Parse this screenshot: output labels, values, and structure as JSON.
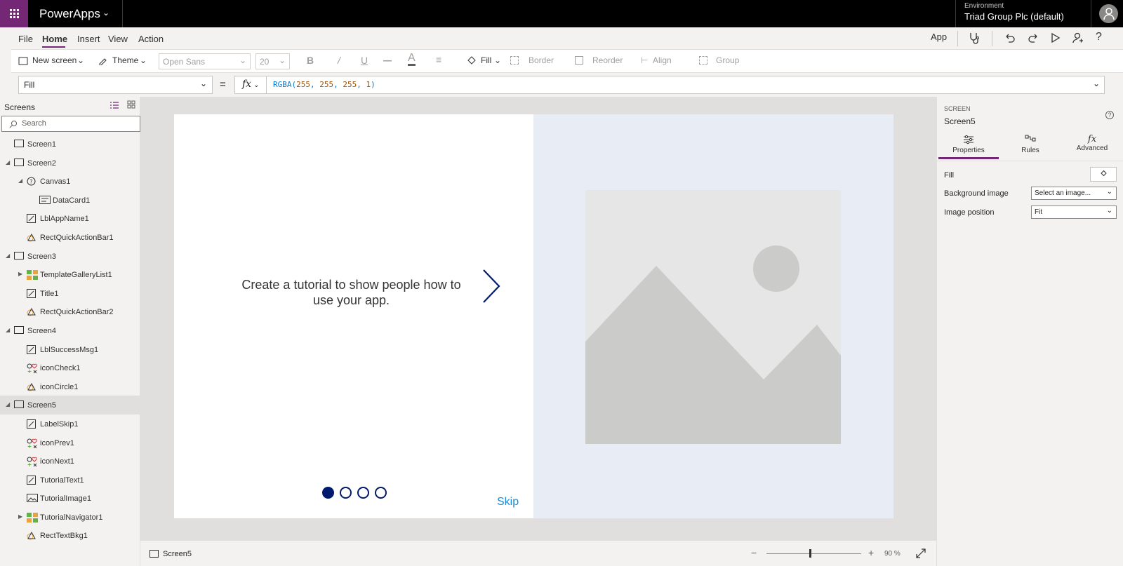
{
  "app": {
    "name": "PowerApps"
  },
  "environment": {
    "label": "Environment",
    "value": "Triad Group Plc (default)"
  },
  "menu": {
    "items": [
      "File",
      "Home",
      "Insert",
      "View",
      "Action"
    ],
    "active": "Home"
  },
  "topright": {
    "app_label": "App"
  },
  "ribbon": {
    "new_screen": "New screen",
    "theme": "Theme",
    "font": "Open Sans",
    "font_size": "20",
    "bold": "B",
    "italic": "/",
    "underline": "U",
    "fill": "Fill",
    "border": "Border",
    "reorder": "Reorder",
    "align": "Align",
    "group": "Group"
  },
  "formula": {
    "property": "Fill",
    "equals": "=",
    "fx": "fx",
    "fn": "RGBA",
    "args": [
      "255",
      "255",
      "255",
      "1"
    ]
  },
  "screens_panel": {
    "title": "Screens",
    "search_placeholder": "Search",
    "tree": [
      {
        "label": "Screen1",
        "icon": "screen-icon",
        "indent": 0,
        "expanded": null
      },
      {
        "label": "Screen2",
        "icon": "screen-icon",
        "indent": 0,
        "expanded": true
      },
      {
        "label": "Canvas1",
        "icon": "canvas-icon",
        "indent": 1,
        "expanded": true
      },
      {
        "label": "DataCard1",
        "icon": "datacard-icon",
        "indent": 2,
        "expanded": null
      },
      {
        "label": "LblAppName1",
        "icon": "label-icon",
        "indent": 1,
        "expanded": null
      },
      {
        "label": "RectQuickActionBar1",
        "icon": "shape-icon",
        "indent": 1,
        "expanded": null
      },
      {
        "label": "Screen3",
        "icon": "screen-icon",
        "indent": 0,
        "expanded": true
      },
      {
        "label": "TemplateGalleryList1",
        "icon": "gallery-icon",
        "indent": 1,
        "expanded": false
      },
      {
        "label": "Title1",
        "icon": "label-icon",
        "indent": 1,
        "expanded": null
      },
      {
        "label": "RectQuickActionBar2",
        "icon": "shape-icon",
        "indent": 1,
        "expanded": null
      },
      {
        "label": "Screen4",
        "icon": "screen-icon",
        "indent": 0,
        "expanded": true
      },
      {
        "label": "LblSuccessMsg1",
        "icon": "label-icon",
        "indent": 1,
        "expanded": null
      },
      {
        "label": "iconCheck1",
        "icon": "icon-control-icon",
        "indent": 1,
        "expanded": null
      },
      {
        "label": "iconCircle1",
        "icon": "shape-icon",
        "indent": 1,
        "expanded": null
      },
      {
        "label": "Screen5",
        "icon": "screen-icon",
        "indent": 0,
        "expanded": true,
        "selected": true
      },
      {
        "label": "LabelSkip1",
        "icon": "label-icon",
        "indent": 1,
        "expanded": null
      },
      {
        "label": "iconPrev1",
        "icon": "icon-control-icon",
        "indent": 1,
        "expanded": null
      },
      {
        "label": "iconNext1",
        "icon": "icon-control-icon",
        "indent": 1,
        "expanded": null
      },
      {
        "label": "TutorialText1",
        "icon": "label-icon",
        "indent": 1,
        "expanded": null
      },
      {
        "label": "TutorialImage1",
        "icon": "image-icon",
        "indent": 1,
        "expanded": null
      },
      {
        "label": "TutorialNavigator1",
        "icon": "gallery-icon",
        "indent": 1,
        "expanded": false
      },
      {
        "label": "RectTextBkg1",
        "icon": "shape-icon",
        "indent": 1,
        "expanded": null
      }
    ]
  },
  "canvas": {
    "tutorial_text": "Create a tutorial to show people how to use your app.",
    "skip_label": "Skip",
    "dots": [
      true,
      false,
      false,
      false
    ],
    "colors": {
      "accent": "#001a70",
      "link": "#1a8bd6",
      "right_bg": "#e8ecf4"
    }
  },
  "statusbar": {
    "screen": "Screen5",
    "zoom": "90 %",
    "zoom_level": 0.45
  },
  "properties_panel": {
    "type": "SCREEN",
    "name": "Screen5",
    "tabs": [
      "Properties",
      "Rules",
      "Advanced"
    ],
    "active_tab": "Properties",
    "rows": [
      {
        "label": "Fill",
        "value": ""
      },
      {
        "label": "Background image",
        "value": "Select an image..."
      },
      {
        "label": "Image position",
        "value": "Fit"
      }
    ]
  }
}
